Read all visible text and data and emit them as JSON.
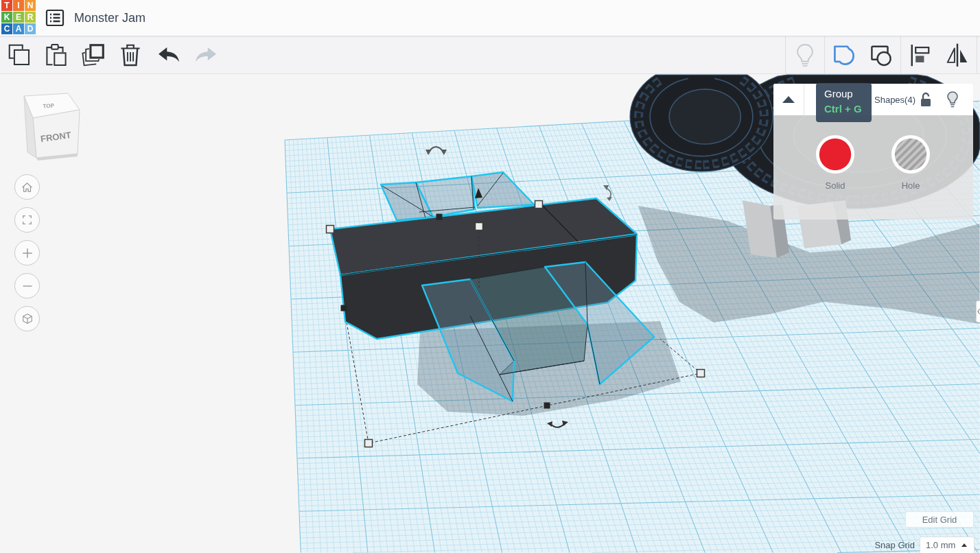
{
  "logo": {
    "tiles": [
      {
        "letter": "T",
        "color": "#e8472b"
      },
      {
        "letter": "I",
        "color": "#f2752d"
      },
      {
        "letter": "N",
        "color": "#f59a30"
      },
      {
        "letter": "K",
        "color": "#4fae48"
      },
      {
        "letter": "E",
        "color": "#8cc240"
      },
      {
        "letter": "R",
        "color": "#b4cc3c"
      },
      {
        "letter": "C",
        "color": "#1f6db8"
      },
      {
        "letter": "A",
        "color": "#3a8fd6"
      },
      {
        "letter": "D",
        "color": "#72b8e4"
      }
    ]
  },
  "design": {
    "title": "Monster Jam"
  },
  "toolbar": {
    "left_groups": [
      {
        "tools": [
          {
            "kind": "copy",
            "disabled": false
          },
          {
            "kind": "paste",
            "disabled": false
          },
          {
            "kind": "duplicate",
            "disabled": false
          },
          {
            "kind": "delete",
            "disabled": false
          }
        ]
      },
      {
        "tools": [
          {
            "kind": "undo",
            "disabled": false
          },
          {
            "kind": "redo",
            "disabled": true
          }
        ]
      }
    ],
    "right_groups": [
      {
        "tools": [
          {
            "kind": "notes",
            "disabled": true,
            "highlighted": false
          }
        ]
      },
      {
        "tools": [
          {
            "kind": "group",
            "disabled": false,
            "highlighted": true
          },
          {
            "kind": "ungroup",
            "disabled": false,
            "highlighted": false
          }
        ]
      },
      {
        "tools": [
          {
            "kind": "align",
            "disabled": false,
            "highlighted": false
          },
          {
            "kind": "mirror",
            "disabled": false,
            "highlighted": false
          }
        ]
      }
    ]
  },
  "view_cube": {
    "top_label": "TOP",
    "front_label": "FRONT"
  },
  "view_controls": [
    {
      "kind": "home"
    },
    {
      "kind": "fit"
    },
    {
      "kind": "zoom_in"
    },
    {
      "kind": "zoom_out"
    },
    {
      "kind": "projection"
    }
  ],
  "shape_panel": {
    "expanded": true,
    "title": "Shapes(4)",
    "locked": false,
    "options": [
      {
        "kind": "solid",
        "label": "Solid"
      },
      {
        "kind": "hole",
        "label": "Hole"
      }
    ]
  },
  "tooltip": {
    "title": "Group",
    "shortcut": "Ctrl + G"
  },
  "grid_controls": {
    "edit_button": "Edit Grid",
    "snap_label": "Snap Grid",
    "snap_value": "1.0 mm"
  }
}
